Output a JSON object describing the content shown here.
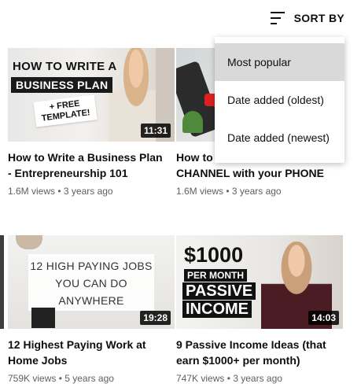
{
  "sort": {
    "label": "SORT BY",
    "icon": "sort-icon"
  },
  "menu": {
    "items": [
      {
        "label": "Most popular",
        "selected": true
      },
      {
        "label": "Date added (oldest)",
        "selected": false
      },
      {
        "label": "Date added (newest)",
        "selected": false
      }
    ]
  },
  "videos": [
    {
      "thumb": {
        "line1": "HOW TO WRITE A",
        "line2": "BUSINESS PLAN",
        "line3": "+ FREE TEMPLATE!"
      },
      "duration": "11:31",
      "title": "How to Write a Business Plan\n- Entrepreneurship 101",
      "meta": "1.6M views • 3 years ago"
    },
    {
      "thumb": {},
      "duration": "",
      "title": "How to ... YOUTUBE\nCHANNEL with your PHONE",
      "meta": "1.6M views • 3 years ago"
    },
    {
      "thumb": {
        "line1": "12 HIGH PAYING JOBS",
        "line2": "YOU CAN DO",
        "line3": "ANYWHERE"
      },
      "duration": "19:28",
      "title": "12 Highest Paying Work at\nHome Jobs",
      "meta": "759K views • 5 years ago"
    },
    {
      "thumb": {
        "line1": "$1000",
        "line2": "PER MONTH",
        "line3": "PASSIVE",
        "line4": "INCOME"
      },
      "duration": "14:03",
      "title": "9 Passive Income Ideas (that\nearn $1000+ per month)",
      "meta": "747K views • 3 years ago"
    }
  ]
}
